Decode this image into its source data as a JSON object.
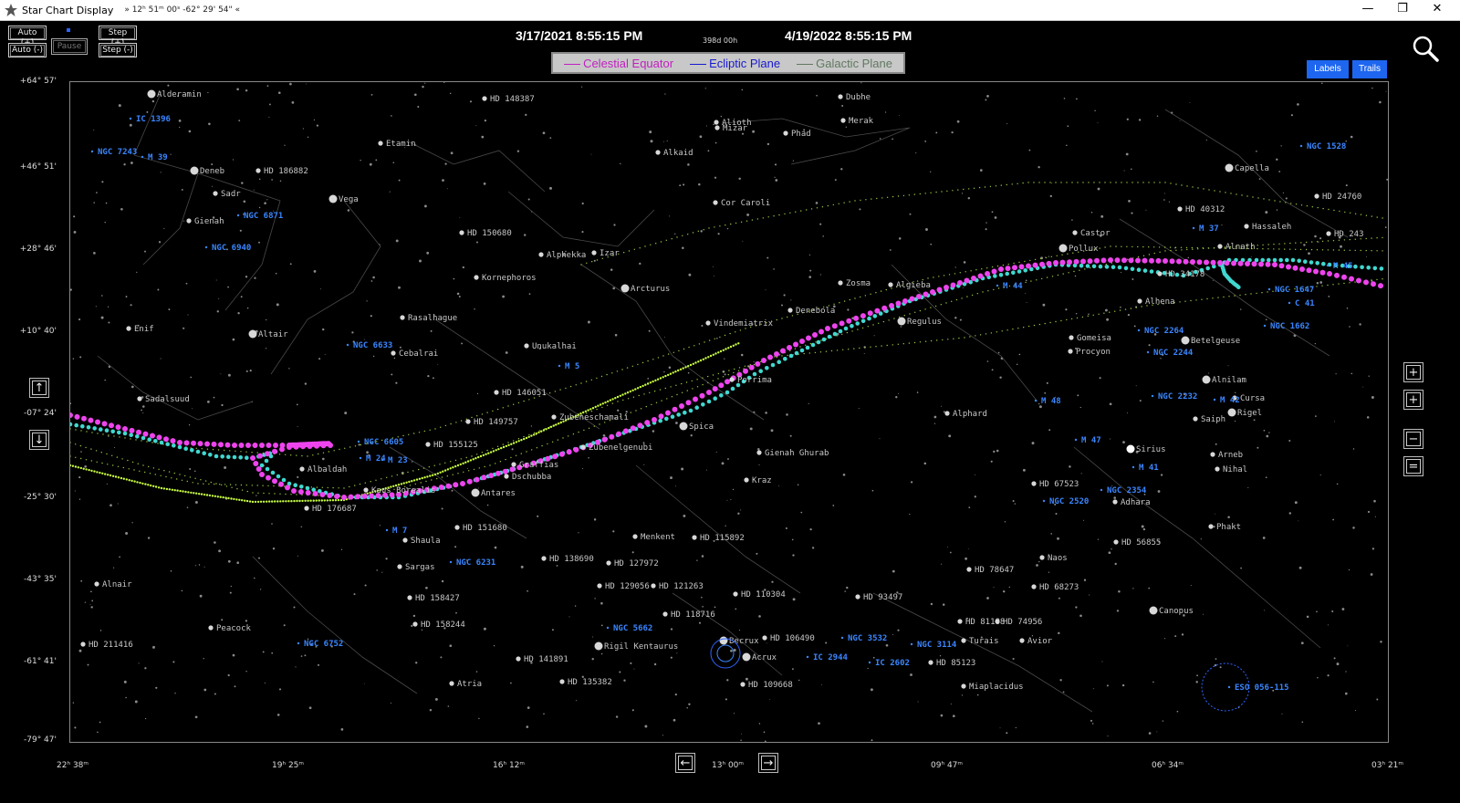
{
  "window": {
    "title": "Star Chart Display",
    "coords": "» 12ʰ 51ᵐ 00ˢ  -62° 29' 54\" «",
    "minimize": "—",
    "maximize": "❐",
    "close": "✕"
  },
  "controls": {
    "auto_plus": "Auto (+)",
    "auto_minus": "Auto (-)",
    "pause": "Pause",
    "step_plus": "Step (+)",
    "step_minus": "Step (-)"
  },
  "header": {
    "start_date": "3/17/2021 8:55:15 PM",
    "end_date": "4/19/2022 8:55:15 PM",
    "span": "398d 00h"
  },
  "legend": [
    {
      "label": "Celestial Equator",
      "color": "#c020c0"
    },
    {
      "label": "Ecliptic Plane",
      "color": "#1818d0"
    },
    {
      "label": "Galactic Plane",
      "color": "#607860"
    }
  ],
  "buttons": {
    "labels": "Labels",
    "trails": "Trails"
  },
  "y_axis": [
    "+64° 57'",
    "+46° 51'",
    "+28° 46'",
    "+10° 40'",
    "-07° 24'",
    "-25° 30'",
    "-43° 35'",
    "-61° 41'",
    "-79° 47'"
  ],
  "x_axis": [
    "22ʰ 38ᵐ",
    "19ʰ 25ᵐ",
    "16ʰ 12ᵐ",
    "13ʰ 00ᵐ",
    "09ʰ 47ᵐ",
    "06ʰ 34ᵐ",
    "03ʰ 21ᵐ"
  ],
  "nav": {
    "up": "↑",
    "down": "↓",
    "left": "←",
    "right": "→",
    "zoom_in_a": "+",
    "zoom_in_b": "+",
    "zoom_out_a": "−",
    "zoom_out_b": "="
  },
  "colors": {
    "star_label": "#c8c8c8",
    "dso_label": "#3a86ff",
    "trail_magenta": "#ee44ee",
    "trail_cyan": "#40d8d0",
    "trail_green": "#c8ff40"
  },
  "icons": {
    "app": "star-icon",
    "search": "magnifier-icon"
  },
  "stars": [
    {
      "name": "Alderamin"
    },
    {
      "name": "Deneb"
    },
    {
      "name": "HD 186882"
    },
    {
      "name": "Sadr"
    },
    {
      "name": "Gienah"
    },
    {
      "name": "Vega"
    },
    {
      "name": "Etamin"
    },
    {
      "name": "HD 148387"
    },
    {
      "name": "Mizar"
    },
    {
      "name": "Alioth"
    },
    {
      "name": "Dubhe"
    },
    {
      "name": "Merak"
    },
    {
      "name": "Phad"
    },
    {
      "name": "Alkaid"
    },
    {
      "name": "Cor Caroli"
    },
    {
      "name": "HD 150680"
    },
    {
      "name": "Alphekka"
    },
    {
      "name": "Izar"
    },
    {
      "name": "Kornephoros"
    },
    {
      "name": "Arcturus"
    },
    {
      "name": "Rasalhague"
    },
    {
      "name": "Cebalrai"
    },
    {
      "name": "Unukalhai"
    },
    {
      "name": "Enif"
    },
    {
      "name": "Altair"
    },
    {
      "name": "Sadalsuud"
    },
    {
      "name": "HD 146051"
    },
    {
      "name": "HD 149757"
    },
    {
      "name": "Zubeneschamali"
    },
    {
      "name": "Zubenelgenubi"
    },
    {
      "name": "HD 155125"
    },
    {
      "name": "Albaldah"
    },
    {
      "name": "Kaus Borealis"
    },
    {
      "name": "Antares"
    },
    {
      "name": "Dschubba"
    },
    {
      "name": "Graffias"
    },
    {
      "name": "HD 176687"
    },
    {
      "name": "HD 151680"
    },
    {
      "name": "Shaula"
    },
    {
      "name": "Sargas"
    },
    {
      "name": "Menkent"
    },
    {
      "name": "HD 115892"
    },
    {
      "name": "HD 138690"
    },
    {
      "name": "HD 127972"
    },
    {
      "name": "HD 129056"
    },
    {
      "name": "HD 121263"
    },
    {
      "name": "HD 118716"
    },
    {
      "name": "HD 110304"
    },
    {
      "name": "HD 158427"
    },
    {
      "name": "HD 158244"
    },
    {
      "name": "Alnair"
    },
    {
      "name": "Peacock"
    },
    {
      "name": "HD 211416"
    },
    {
      "name": "HD 141891"
    },
    {
      "name": "Rigil Kentaurus"
    },
    {
      "name": "Atria"
    },
    {
      "name": "HD 135382"
    },
    {
      "name": "Becrux"
    },
    {
      "name": "Acrux"
    },
    {
      "name": "HD 106490"
    },
    {
      "name": "HD 109668"
    },
    {
      "name": "Vindemiatrix"
    },
    {
      "name": "Porrima"
    },
    {
      "name": "Spica"
    },
    {
      "name": "Gienah Ghurab"
    },
    {
      "name": "Kraz"
    },
    {
      "name": "Zosma"
    },
    {
      "name": "Denebola"
    },
    {
      "name": "Algieba"
    },
    {
      "name": "Regulus"
    },
    {
      "name": "Alphard"
    },
    {
      "name": "HD 93497"
    },
    {
      "name": "HD 78647"
    },
    {
      "name": "HD 68273"
    },
    {
      "name": "HD 81188"
    },
    {
      "name": "HD 74956"
    },
    {
      "name": "Turais"
    },
    {
      "name": "Avior"
    },
    {
      "name": "HD 85123"
    },
    {
      "name": "Miaplacidus"
    },
    {
      "name": "Canopus"
    },
    {
      "name": "Castor"
    },
    {
      "name": "Pollux"
    },
    {
      "name": "Alhena"
    },
    {
      "name": "Gomeisa"
    },
    {
      "name": "Procyon"
    },
    {
      "name": "Betelgeuse"
    },
    {
      "name": "Alnilam"
    },
    {
      "name": "Saiph"
    },
    {
      "name": "Rigel"
    },
    {
      "name": "Cursa"
    },
    {
      "name": "Sirius"
    },
    {
      "name": "Arneb"
    },
    {
      "name": "Nihal"
    },
    {
      "name": "HD 67523"
    },
    {
      "name": "Adhara"
    },
    {
      "name": "Naos"
    },
    {
      "name": "HD 56855"
    },
    {
      "name": "Phakt"
    },
    {
      "name": "Capella"
    },
    {
      "name": "HD 40312"
    },
    {
      "name": "Hassaleh"
    },
    {
      "name": "Alnath"
    },
    {
      "name": "HD 24760"
    },
    {
      "name": "HD 243"
    },
    {
      "name": "HD 34178"
    }
  ],
  "dsos": [
    {
      "name": "IC 1396"
    },
    {
      "name": "NGC 7243"
    },
    {
      "name": "M 39"
    },
    {
      "name": "NGC 6871"
    },
    {
      "name": "NGC 6940"
    },
    {
      "name": "NGC 6633"
    },
    {
      "name": "M 5"
    },
    {
      "name": "NGC 6605"
    },
    {
      "name": "M 24"
    },
    {
      "name": "M 23"
    },
    {
      "name": "M 7"
    },
    {
      "name": "NGC 6231"
    },
    {
      "name": "NGC 5662"
    },
    {
      "name": "NGC 6752"
    },
    {
      "name": "IC 2944"
    },
    {
      "name": "NGC 3532"
    },
    {
      "name": "IC 2602"
    },
    {
      "name": "NGC 3114"
    },
    {
      "name": "M 44"
    },
    {
      "name": "M 48"
    },
    {
      "name": "M 47"
    },
    {
      "name": "M 41"
    },
    {
      "name": "NGC 2354"
    },
    {
      "name": "NGC 2520"
    },
    {
      "name": "NGC 2264"
    },
    {
      "name": "NGC 2244"
    },
    {
      "name": "NGC 2232"
    },
    {
      "name": "M 42"
    },
    {
      "name": "M 37"
    },
    {
      "name": "NGC 1528"
    },
    {
      "name": "NGC 1647"
    },
    {
      "name": "NGC 1662"
    },
    {
      "name": "C 41"
    },
    {
      "name": "M 45"
    },
    {
      "name": "ESO 056-115"
    }
  ]
}
